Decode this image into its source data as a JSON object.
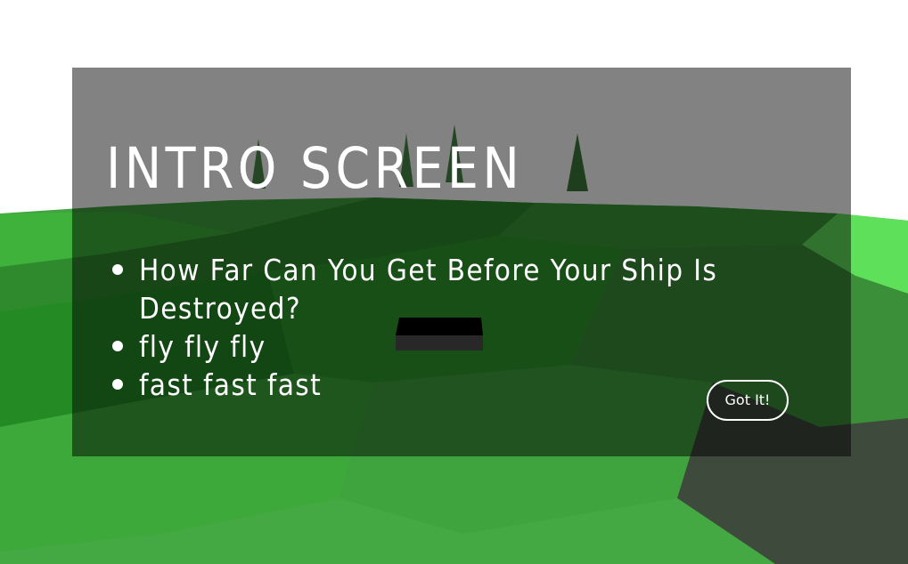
{
  "intro": {
    "title": "INTRO SCREEN",
    "items": [
      "How Far Can You Get Before Your Ship Is Destroyed?",
      "fly fly fly",
      "fast fast fast"
    ],
    "button_label": "Got It!"
  },
  "colors": {
    "sky": "#ffffff",
    "ground_light": "#42a840",
    "ground_dark": "#2a7a29",
    "overlay": "rgba(0,0,0,0.49)",
    "text": "#ffffff"
  },
  "icons": {
    "ship": "dark-box-ship",
    "trees": "cone-tree"
  }
}
